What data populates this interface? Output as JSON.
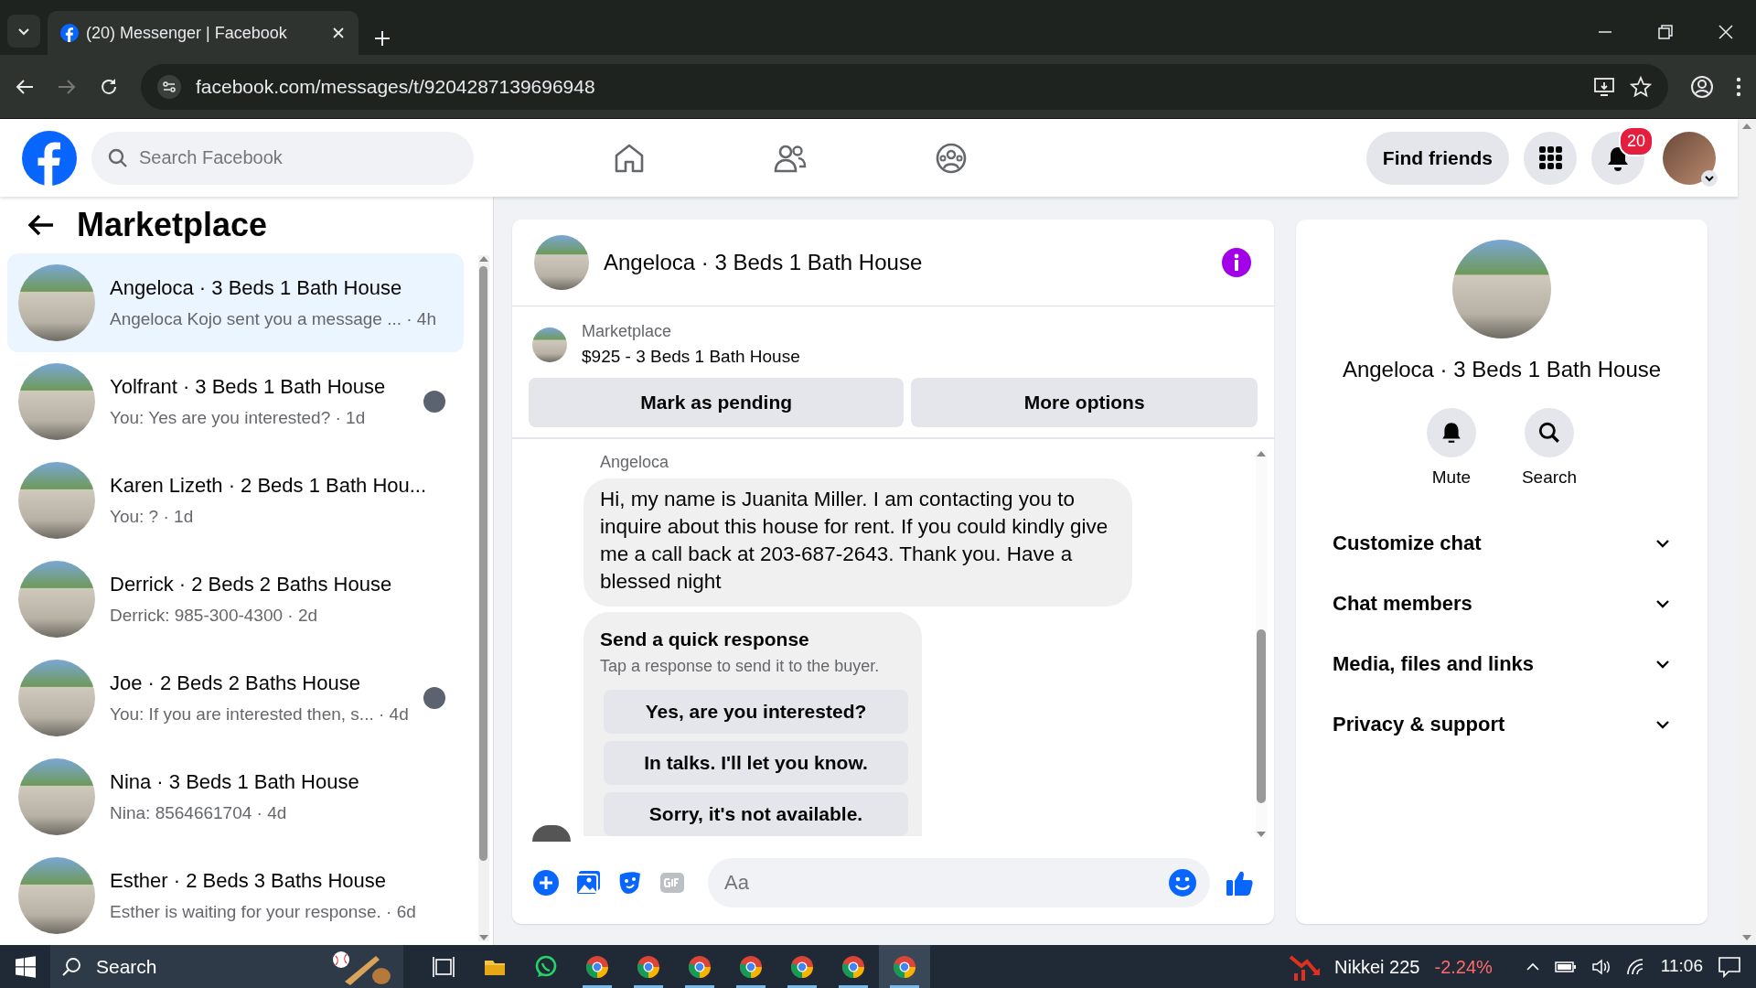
{
  "browser": {
    "tab_title": "(20) Messenger | Facebook",
    "url": "facebook.com/messages/t/9204287139696948"
  },
  "topnav": {
    "search_placeholder": "Search Facebook",
    "nav_items": [
      {
        "kind": "home"
      },
      {
        "kind": "friends"
      },
      {
        "kind": "groups"
      }
    ],
    "find_friends": "Find friends",
    "notification_count": "20"
  },
  "sidebar": {
    "title": "Marketplace",
    "conversations": [
      {
        "title": "Angeloca · 3 Beds 1 Bath House",
        "preview": "Angeloca Kojo sent you a message ... · 4h",
        "selected": true,
        "seen_avatar": false
      },
      {
        "title": "Yolfrant · 3 Beds 1 Bath House",
        "preview": "You: Yes are you interested? · 1d",
        "selected": false,
        "seen_avatar": true
      },
      {
        "title": "Karen Lizeth · 2 Beds 1 Bath Hou...",
        "preview": "You: ? · 1d",
        "selected": false,
        "seen_avatar": false
      },
      {
        "title": "Derrick · 2 Beds 2 Baths House",
        "preview": "Derrick: 985-300-4300 · 2d",
        "selected": false,
        "seen_avatar": false
      },
      {
        "title": "Joe · 2 Beds 2 Baths House",
        "preview": "You: If you are interested then, s... · 4d",
        "selected": false,
        "seen_avatar": true
      },
      {
        "title": "Nina · 3 Beds 1 Bath House",
        "preview": "Nina: 8564661704 · 4d",
        "selected": false,
        "seen_avatar": false
      },
      {
        "title": "Esther · 2 Beds 3 Baths House",
        "preview": "Esther is waiting for your response. · 6d",
        "selected": false,
        "seen_avatar": false
      }
    ]
  },
  "chat": {
    "title": "Angeloca · 3 Beds 1 Bath House",
    "listing": {
      "label": "Marketplace",
      "title": "$925 - 3 Beds 1 Bath House"
    },
    "buttons": [
      "Mark as pending",
      "More options"
    ],
    "sender": "Angeloca",
    "message": "Hi, my name is Juanita Miller. I am contacting you to inquire about this house for rent. If you could kindly give me a call back at 203-687-2643. Thank you. Have a blessed night",
    "quick_response": {
      "title": "Send a quick response",
      "subtitle": "Tap a response to send it to the buyer.",
      "options": [
        "Yes, are you interested?",
        "In talks. I'll let you know.",
        "Sorry, it's not available."
      ]
    },
    "composer": {
      "placeholder": "Aa"
    }
  },
  "details": {
    "title": "Angeloca · 3 Beds 1 Bath House",
    "actions": [
      {
        "kind": "mute",
        "label": "Mute"
      },
      {
        "kind": "search",
        "label": "Search"
      }
    ],
    "sections": [
      {
        "label": "Customize chat",
        "expanded": false
      },
      {
        "label": "Chat members",
        "expanded": false
      },
      {
        "label": "Media, files and links",
        "expanded": false
      },
      {
        "label": "Privacy & support",
        "expanded": false
      }
    ]
  },
  "taskbar": {
    "search_placeholder": "Search",
    "apps": [
      {
        "kind": "task_view",
        "selected": false,
        "running": false
      },
      {
        "kind": "explorer",
        "selected": false,
        "running": false
      },
      {
        "kind": "whatsapp",
        "selected": false,
        "running": false
      },
      {
        "kind": "chrome",
        "selected": false,
        "running": true
      },
      {
        "kind": "chrome",
        "selected": false,
        "running": true
      },
      {
        "kind": "chrome",
        "selected": false,
        "running": true
      },
      {
        "kind": "chrome",
        "selected": false,
        "running": true
      },
      {
        "kind": "chrome",
        "selected": false,
        "running": true
      },
      {
        "kind": "chrome",
        "selected": false,
        "running": true
      },
      {
        "kind": "chrome",
        "selected": true,
        "running": true
      }
    ],
    "ticker": {
      "name": "Nikkei 225",
      "change": "-2.24%"
    },
    "time": "11:06"
  }
}
